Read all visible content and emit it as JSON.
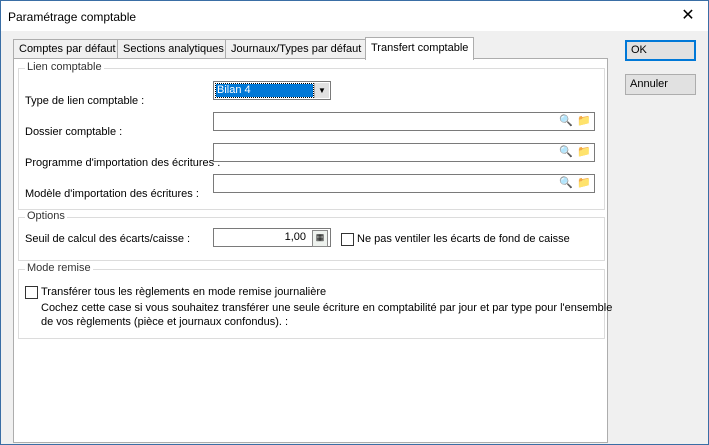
{
  "window": {
    "title": "Paramétrage comptable",
    "close_glyph": "✕"
  },
  "tabs": [
    {
      "label": "Comptes par défaut"
    },
    {
      "label": "Sections analytiques"
    },
    {
      "label": "Journaux/Types par défaut"
    },
    {
      "label": "Transfert comptable"
    }
  ],
  "lien": {
    "title": "Lien comptable",
    "type_label": "Type de lien comptable :",
    "type_value": "Bilan 4",
    "dossier_label": "Dossier comptable :",
    "dossier_value": "",
    "programme_label": "Programme d'importation des écritures :",
    "programme_value": "",
    "modele_label": "Modèle d'importation des écritures :",
    "modele_value": ""
  },
  "options": {
    "title": "Options",
    "seuil_label": "Seuil de calcul des écarts/caisse :",
    "seuil_value": "1,00",
    "ventiler_label": "Ne pas ventiler les écarts de fond de caisse",
    "ventiler_checked": false
  },
  "remise": {
    "title": "Mode remise",
    "transferer_label": "Transférer tous les règlements en mode remise journalière",
    "transferer_checked": false,
    "help_line1": "Cochez cette case si vous souhaitez transférer une seule écriture en comptabilité par jour et par type pour l'ensemble",
    "help_line2": "de vos règlements (pièce et journaux confondus). :"
  },
  "buttons": {
    "ok": "OK",
    "cancel": "Annuler"
  },
  "colors": {
    "selection": "#0078d7",
    "default_button_border": "#0078d7",
    "folder_icon": "#e8b020"
  }
}
